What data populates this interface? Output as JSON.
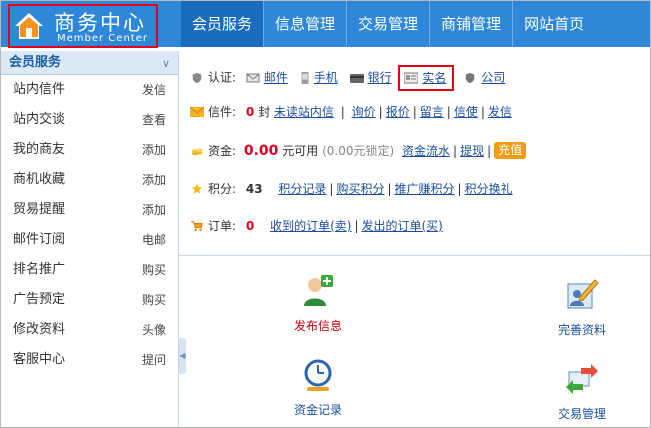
{
  "header": {
    "logo_title": "商务中心",
    "logo_subtitle": "Member Center",
    "nav": [
      {
        "label": "会员服务",
        "active": true
      },
      {
        "label": "信息管理",
        "active": false
      },
      {
        "label": "交易管理",
        "active": false
      },
      {
        "label": "商铺管理",
        "active": false
      },
      {
        "label": "网站首页",
        "active": false
      }
    ]
  },
  "sidebar": {
    "title": "会员服务",
    "items": [
      {
        "label": "站内信件",
        "action": "发信"
      },
      {
        "label": "站内交谈",
        "action": "查看"
      },
      {
        "label": "我的商友",
        "action": "添加"
      },
      {
        "label": "商机收藏",
        "action": "添加"
      },
      {
        "label": "贸易提醒",
        "action": "添加"
      },
      {
        "label": "邮件订阅",
        "action": "电邮"
      },
      {
        "label": "排名推广",
        "action": "购买"
      },
      {
        "label": "广告预定",
        "action": "购买"
      },
      {
        "label": "修改资料",
        "action": "头像"
      },
      {
        "label": "客服中心",
        "action": "提问"
      }
    ]
  },
  "verify": {
    "label": "认证:",
    "email": "邮件",
    "phone": "手机",
    "bank": "银行",
    "realname": "实名",
    "company": "公司"
  },
  "mail": {
    "label": "信件:",
    "count": "0",
    "unit": "封",
    "unread": "未读站内信",
    "links": [
      "询价",
      "报价",
      "留言",
      "信使",
      "发信"
    ]
  },
  "funds": {
    "label": "资金:",
    "amount": "0.00",
    "available": "元可用",
    "locked": "(0.00元锁定)",
    "links": [
      "资金流水",
      "提现"
    ],
    "recharge": "充值"
  },
  "points": {
    "label": "积分:",
    "value": "43",
    "links": [
      "积分记录",
      "购买积分",
      "推广赚积分",
      "积分换礼"
    ]
  },
  "orders": {
    "label": "订单:",
    "count": "0",
    "links": [
      "收到的订单(卖)",
      "发出的订单(买)"
    ]
  },
  "tiles": {
    "publish": "发布信息",
    "profile": "完善资料",
    "funds_record": "资金记录",
    "trade": "交易管理"
  },
  "colors": {
    "header_bg": "#2e87d8",
    "nav_active": "#1a6cbf",
    "highlight_border": "#e3001b",
    "amount_red": "#e3001b",
    "recharge_orange": "#f39c12"
  }
}
